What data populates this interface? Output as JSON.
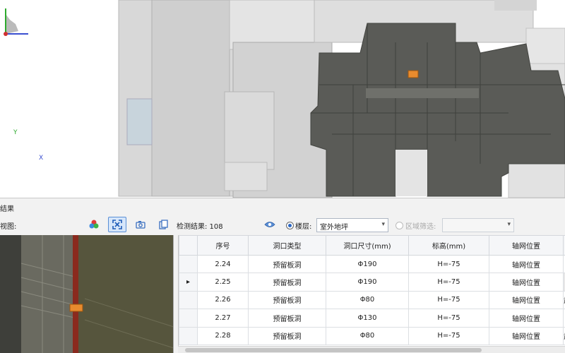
{
  "panel": {
    "title": "结果"
  },
  "toolbar": {
    "view_label": "视图:",
    "result_label": "检测结果: 108",
    "floor_label": "楼层:",
    "floor_value": "室外地坪",
    "region_label": "区域筛选:",
    "region_value": ""
  },
  "table": {
    "headers": [
      "序号",
      "洞口类型",
      "洞口尺寸(mm)",
      "标高(mm)",
      "轴网位置"
    ],
    "rows": [
      {
        "seq": "2.24",
        "type": "预留板洞",
        "size": "Φ190",
        "elev": "H=-75",
        "pos": "轴网位置",
        "extra": ""
      },
      {
        "seq": "2.25",
        "type": "预留板洞",
        "size": "Φ190",
        "elev": "H=-75",
        "pos": "轴网位置",
        "extra": "",
        "marker": "▸"
      },
      {
        "seq": "2.26",
        "type": "预留板洞",
        "size": "Φ80",
        "elev": "H=-75",
        "pos": "轴网位置",
        "extra": "武"
      },
      {
        "seq": "2.27",
        "type": "预留板洞",
        "size": "Φ130",
        "elev": "H=-75",
        "pos": "轴网位置",
        "extra": ""
      },
      {
        "seq": "2.28",
        "type": "预留板洞",
        "size": "Φ80",
        "elev": "H=-75",
        "pos": "轴网位置",
        "extra": "武"
      }
    ]
  },
  "axes": {
    "y": "Y",
    "x": "X"
  },
  "colors": {
    "accent": "#2a66c4",
    "model_dark": "#5a5b57",
    "model_light": "#dcdcdc",
    "marker": "#e88b2e"
  }
}
